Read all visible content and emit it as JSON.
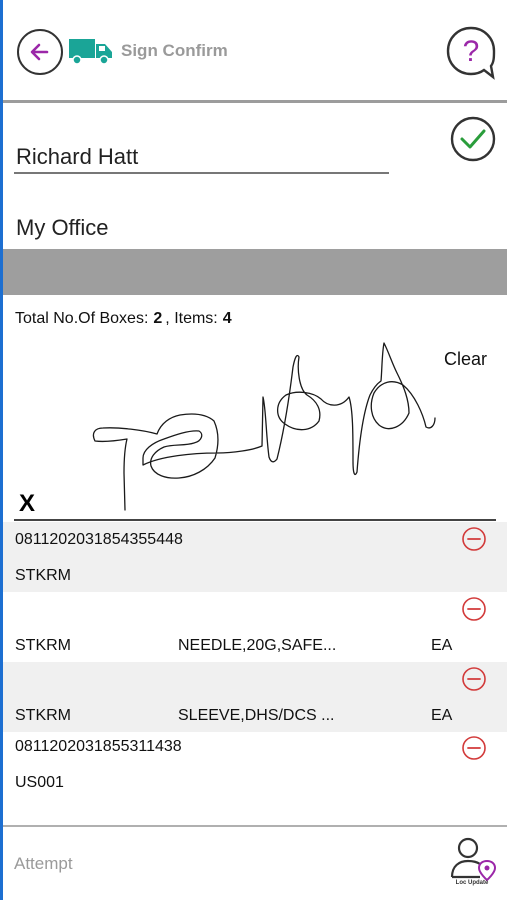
{
  "header": {
    "title": "Sign Confirm",
    "back_icon": "arrow-left-icon",
    "truck_icon": "truck-icon",
    "help_icon": "question-bubble-icon",
    "accent": "#9b27a8",
    "truck_color": "#1aa597"
  },
  "form": {
    "recipient_name": "Richard Hatt",
    "location": "My Office",
    "confirm_icon": "check-circle-icon",
    "confirm_color": "#2a9d3b"
  },
  "totals": {
    "boxes_label": "Total No.Of Boxes:",
    "boxes": "2",
    "items_label": ", Items:",
    "items": "4"
  },
  "signature": {
    "clear_label": "Clear",
    "x_mark": "X"
  },
  "list": {
    "rows": [
      {
        "line1": "0811202031854355448",
        "line2": "STKRM",
        "description": "",
        "uom": ""
      },
      {
        "line1": "",
        "line2": "STKRM",
        "description": "NEEDLE,20G,SAFE...",
        "uom": "EA"
      },
      {
        "line1": "",
        "line2": "STKRM",
        "description": "SLEEVE,DHS/DCS ...",
        "uom": "EA"
      },
      {
        "line1": "0811202031855311438",
        "line2": "US001",
        "description": "",
        "uom": ""
      }
    ],
    "remove_icon": "minus-circle-icon",
    "remove_color": "#d23a3a"
  },
  "footer": {
    "attempt_label": "Attempt",
    "loc_update_label": "Loc Update",
    "loc_update_icon": "user-location-icon"
  }
}
